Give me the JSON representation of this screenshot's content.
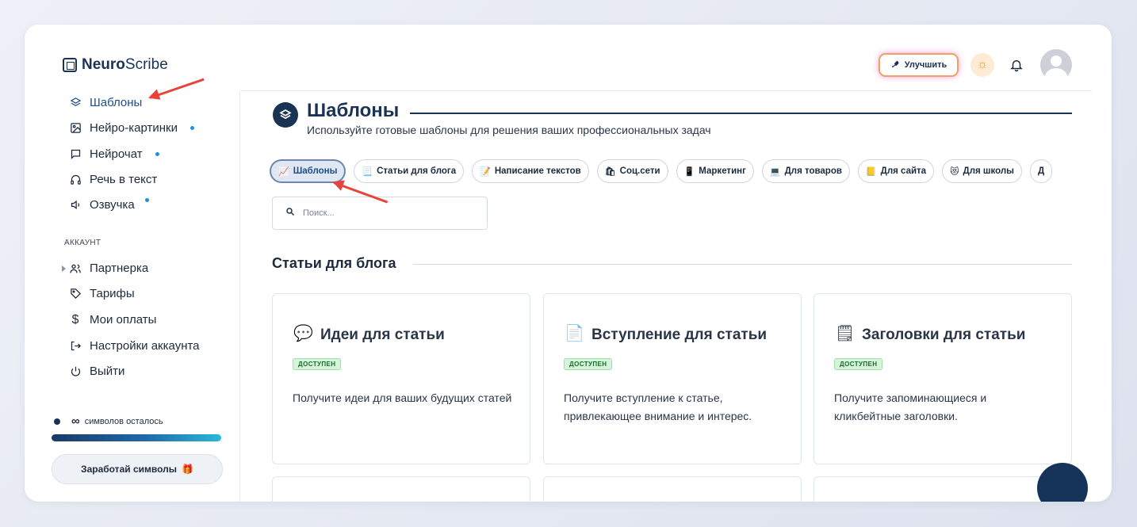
{
  "app": {
    "logo_bold": "Neuro",
    "logo_regular": "Scribe"
  },
  "header": {
    "upgrade_label": "Улучшить"
  },
  "sidebar": {
    "items": [
      {
        "label": "Шаблоны",
        "icon": "layers-icon",
        "active": true
      },
      {
        "label": "Нейро-картинки",
        "icon": "image-icon"
      },
      {
        "label": "Нейрочат",
        "icon": "chat-icon"
      },
      {
        "label": "Речь в текст",
        "icon": "headphones-icon"
      },
      {
        "label": "Озвучка",
        "icon": "speaker-icon"
      }
    ],
    "account_label": "АККАУНТ",
    "account_items": [
      {
        "label": "Партнерка",
        "icon": "users-icon"
      },
      {
        "label": "Тарифы",
        "icon": "tag-icon"
      },
      {
        "label": "Мои оплаты",
        "icon": "dollar-icon"
      },
      {
        "label": "Настройки аккаунта",
        "icon": "logout-arrow-icon"
      },
      {
        "label": "Выйти",
        "icon": "power-icon"
      }
    ],
    "quota_value": "∞",
    "quota_text": "символов осталось",
    "earn_label": "Заработай символы"
  },
  "main": {
    "title": "Шаблоны",
    "subtitle": "Используйте готовые шаблоны для решения ваших профессиональных задач",
    "chips": [
      {
        "label": "Шаблоны",
        "emoji": "📈",
        "active": true
      },
      {
        "label": "Статьи для блога",
        "emoji": "📃"
      },
      {
        "label": "Написание текстов",
        "emoji": "📝"
      },
      {
        "label": "Соц.сети",
        "emoji": "🛍"
      },
      {
        "label": "Маркетинг",
        "emoji": "📱"
      },
      {
        "label": "Для товаров",
        "emoji": "💻"
      },
      {
        "label": "Для сайта",
        "emoji": "📒"
      },
      {
        "label": "Для школы",
        "emoji": "😻"
      },
      {
        "label": "Д",
        "emoji": ""
      }
    ],
    "search_placeholder": "Поиск...",
    "section_title": "Статьи для блога",
    "cards": [
      {
        "title": "Идеи для статьи",
        "icon": "speech-bubble-icon",
        "glyph": "💬",
        "badge": "ДОСТУПЕН",
        "desc": "Получите идеи для ваших будущих статей"
      },
      {
        "title": "Вступление для статьи",
        "icon": "document-lines-icon",
        "glyph": "📄",
        "badge": "ДОСТУПЕН",
        "desc": "Получите вступление к статье, привлекающее внимание и интерес."
      },
      {
        "title": "Заголовки для статьи",
        "icon": "notepad-icon",
        "glyph": "🗒",
        "badge": "ДОСТУПЕН",
        "desc": "Получите запоминающиеся и кликбейтные заголовки."
      }
    ]
  },
  "colors": {
    "brand_navy": "#1a3253",
    "accent_blue": "#1f8fe0",
    "annotation_red": "#e8433a",
    "badge_green": "#d4f5d9"
  }
}
